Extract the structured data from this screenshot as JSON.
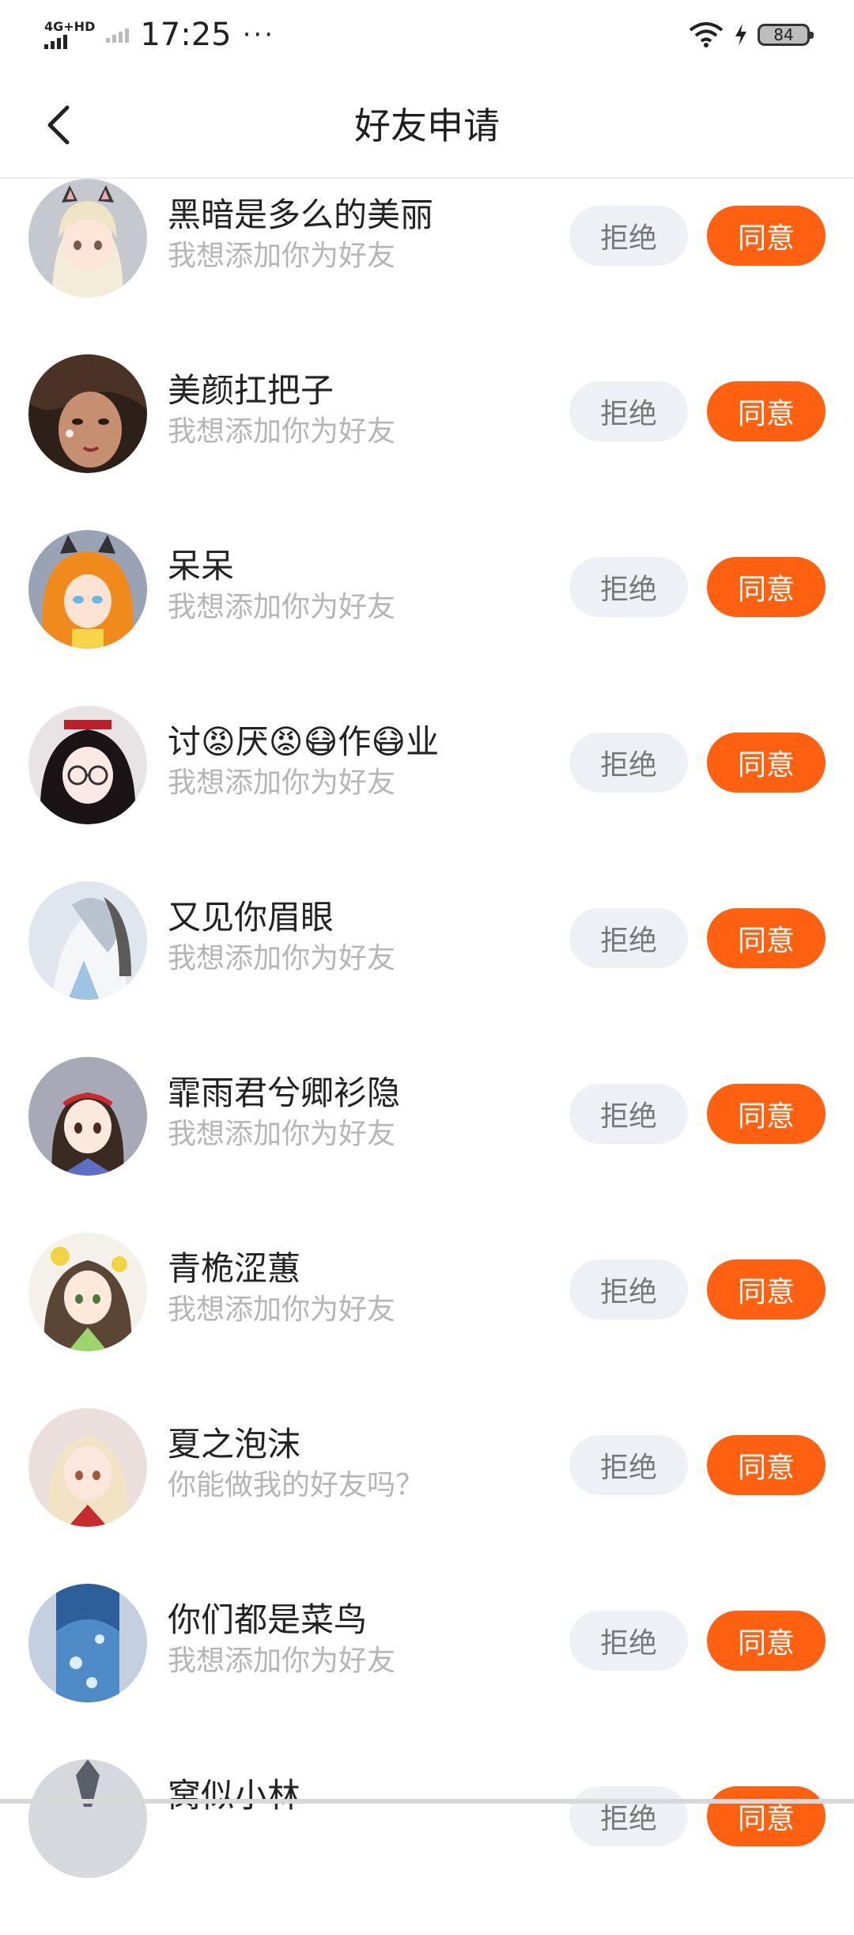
{
  "status_bar": {
    "network": "4G+HD",
    "time": "17:25",
    "more": "···",
    "battery": "84"
  },
  "header": {
    "title": "好友申请"
  },
  "requests": [
    {
      "name": "黑暗是多么的美丽",
      "message": "我想添加你为好友",
      "reject": "拒绝",
      "accept": "同意"
    },
    {
      "name": "美颜扛把子",
      "message": "我想添加你为好友",
      "reject": "拒绝",
      "accept": "同意"
    },
    {
      "name": "呆呆",
      "message": "我想添加你为好友",
      "reject": "拒绝",
      "accept": "同意"
    },
    {
      "name": "讨😡厌😡😷作😷业",
      "message": "我想添加你为好友",
      "reject": "拒绝",
      "accept": "同意"
    },
    {
      "name": "又见你眉眼",
      "message": "我想添加你为好友",
      "reject": "拒绝",
      "accept": "同意"
    },
    {
      "name": "霏雨君兮卿衫隐",
      "message": "我想添加你为好友",
      "reject": "拒绝",
      "accept": "同意"
    },
    {
      "name": "青桅涩蕙",
      "message": "我想添加你为好友",
      "reject": "拒绝",
      "accept": "同意"
    },
    {
      "name": "夏之泡沫",
      "message": "你能做我的好友吗？",
      "reject": "拒绝",
      "accept": "同意"
    },
    {
      "name": "你们都是菜鸟",
      "message": "我想添加你为好友",
      "reject": "拒绝",
      "accept": "同意"
    },
    {
      "name": "窝似小林",
      "message": "",
      "reject": "拒绝",
      "accept": "同意"
    }
  ],
  "colors": {
    "accent": "#ff6111",
    "reject_bg": "#eff0f5",
    "subtext": "#b5b5b5"
  }
}
